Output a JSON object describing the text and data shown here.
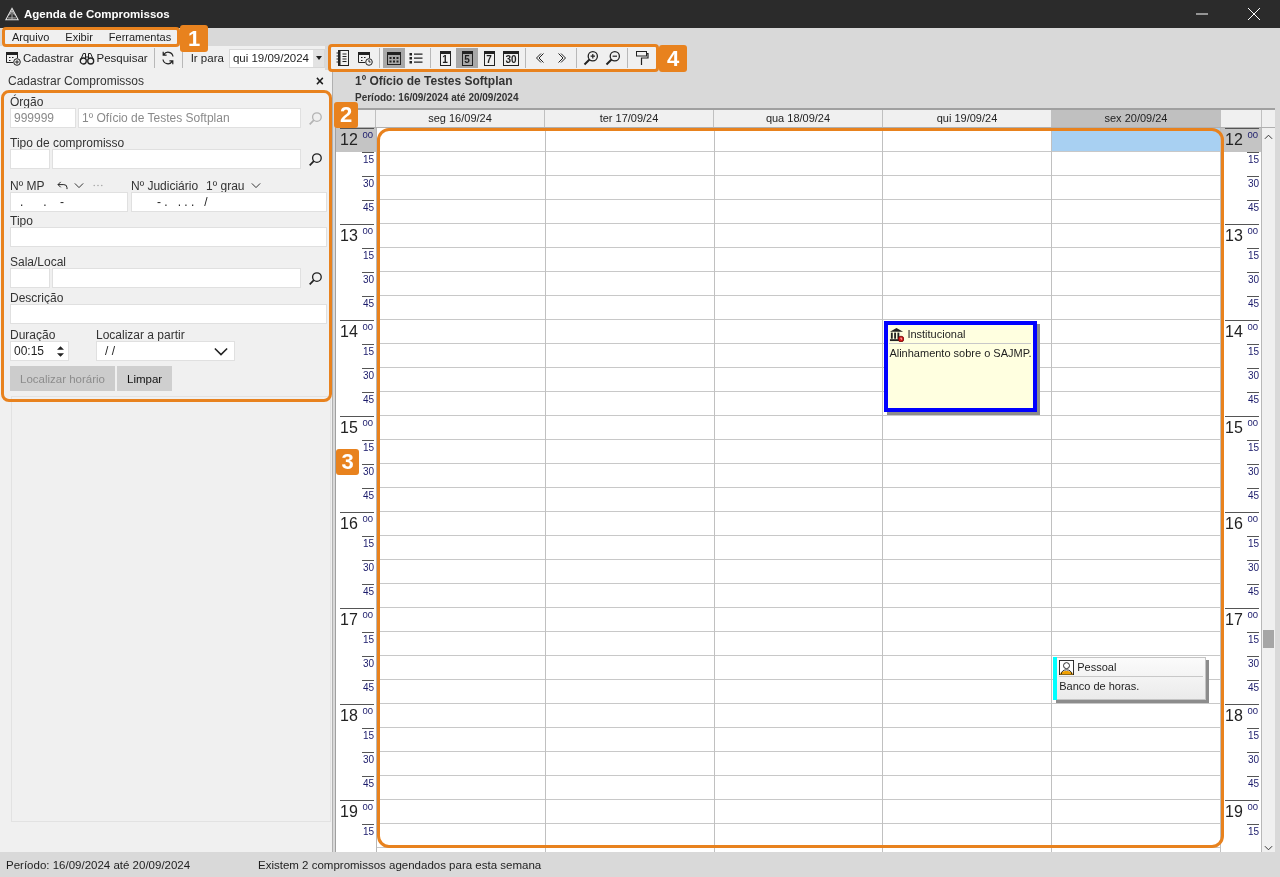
{
  "window": {
    "title": "Agenda de Compromissos"
  },
  "menu_bar": {
    "callout": "1",
    "items": [
      "Arquivo",
      "Exibir",
      "Ferramentas"
    ]
  },
  "toolbar": {
    "groups": [
      [
        {
          "kind": "register",
          "label": "Cadastrar"
        },
        {
          "kind": "search",
          "label": "Pesquisar"
        }
      ],
      [
        {
          "kind": "refresh"
        }
      ]
    ],
    "goto": {
      "label": "Ir para",
      "value": "qui 19/09/2024"
    }
  },
  "view_toolbar": {
    "callout": "4",
    "groups": [
      [
        {
          "kind": "agenda",
          "selected": false
        },
        {
          "kind": "timeline",
          "selected": false
        }
      ],
      [
        {
          "kind": "grid",
          "selected": true
        },
        {
          "kind": "list",
          "selected": false
        }
      ],
      [
        {
          "kind": "period",
          "label": "1",
          "selected": false
        },
        {
          "kind": "period",
          "label": "5",
          "selected": true
        },
        {
          "kind": "period",
          "label": "7",
          "selected": false
        },
        {
          "kind": "period",
          "label": "30",
          "selected": false
        }
      ],
      [
        {
          "kind": "previous"
        },
        {
          "kind": "next"
        }
      ],
      [
        {
          "kind": "zoom_in"
        },
        {
          "kind": "zoom_out"
        }
      ],
      [
        {
          "kind": "pin"
        }
      ]
    ]
  },
  "side_panel": {
    "title": "Cadastrar Compromissos",
    "close": "×"
  },
  "form": {
    "callout": "2",
    "orgao": {
      "label": "Órgão",
      "code": "999999",
      "name": "1º Ofício de Testes Softplan",
      "disabled": true
    },
    "tipo_compromisso": {
      "label": "Tipo de compromisso",
      "disabled": false
    },
    "numero_mp": {
      "label": "Nº MP",
      "value": ".      .    -"
    },
    "numero_judiciario": {
      "label": "Nº Judiciário",
      "instance": "1º grau",
      "value": "- .   . . .   /"
    },
    "tipo": {
      "label": "Tipo"
    },
    "sala_local": {
      "label": "Sala/Local",
      "disabled": false
    },
    "descricao": {
      "label": "Descrição"
    },
    "duracao": {
      "label": "Duração",
      "value": "00:15"
    },
    "localizar_a_partir": {
      "label": "Localizar a partir",
      "value": "/ /"
    },
    "buttons": [
      {
        "label": "Localizar horário",
        "disabled": true
      },
      {
        "label": "Limpar",
        "disabled": false
      }
    ]
  },
  "calendar": {
    "callout": "3",
    "title": "1º Ofício de Testes Softplan",
    "period": "Período: 16/09/2024 até 20/09/2024",
    "days": [
      {
        "label": "seg 16/09/24",
        "selected": false
      },
      {
        "label": "ter 17/09/24",
        "selected": false
      },
      {
        "label": "qua 18/09/24",
        "selected": false
      },
      {
        "label": "qui 19/09/24",
        "selected": false,
        "events": [
          {
            "kind": "institutional",
            "category": "Institucional",
            "text": "Alinhamento sobre o SAJMP.",
            "color": "#0000ff",
            "selected": true
          }
        ]
      },
      {
        "label": "sex 20/09/24",
        "selected": true,
        "events": [
          {
            "kind": "personal",
            "category": "Pessoal",
            "text": "Banco de horas.",
            "color": "#00ffff",
            "selected": false
          }
        ]
      }
    ],
    "left_gutter": [
      {
        "hour": "12",
        "minutes": [
          "00",
          "15",
          "30",
          "45"
        ],
        "selected": true
      },
      {
        "hour": "13",
        "minutes": [
          "00",
          "15",
          "30",
          "45"
        ],
        "selected": false
      },
      {
        "hour": "14",
        "minutes": [
          "00",
          "15",
          "30",
          "45"
        ],
        "selected": false
      },
      {
        "hour": "15",
        "minutes": [
          "00",
          "15",
          "30",
          "45"
        ],
        "selected": false
      },
      {
        "hour": "16",
        "minutes": [
          "00",
          "15",
          "30",
          "45"
        ],
        "selected": false
      },
      {
        "hour": "17",
        "minutes": [
          "00",
          "15",
          "30",
          "45"
        ],
        "selected": false
      },
      {
        "hour": "18",
        "minutes": [
          "00",
          "15",
          "30",
          "45"
        ],
        "selected": false
      },
      {
        "hour": "19",
        "minutes": [
          "00",
          "15"
        ],
        "selected": false
      }
    ],
    "right_gutter": [
      {
        "hour": "12",
        "minutes": [
          "00",
          "15",
          "30",
          "45"
        ],
        "selected": true
      },
      {
        "hour": "13",
        "minutes": [
          "00",
          "15",
          "30",
          "45"
        ],
        "selected": false
      },
      {
        "hour": "14",
        "minutes": [
          "00",
          "15",
          "30",
          "45"
        ],
        "selected": false
      },
      {
        "hour": "15",
        "minutes": [
          "00",
          "15",
          "30",
          "45"
        ],
        "selected": false
      },
      {
        "hour": "16",
        "minutes": [
          "00",
          "15",
          "30",
          "45"
        ],
        "selected": false
      },
      {
        "hour": "17",
        "minutes": [
          "00",
          "15",
          "30",
          "45"
        ],
        "selected": false
      },
      {
        "hour": "18",
        "minutes": [
          "00",
          "15",
          "30",
          "45"
        ],
        "selected": false
      },
      {
        "hour": "19",
        "minutes": [
          "00",
          "15"
        ],
        "selected": false
      }
    ]
  },
  "status_bar": {
    "period": "Período: 16/09/2024 até 20/09/2024",
    "message": "Existem 2 compromissos agendados para esta semana"
  }
}
